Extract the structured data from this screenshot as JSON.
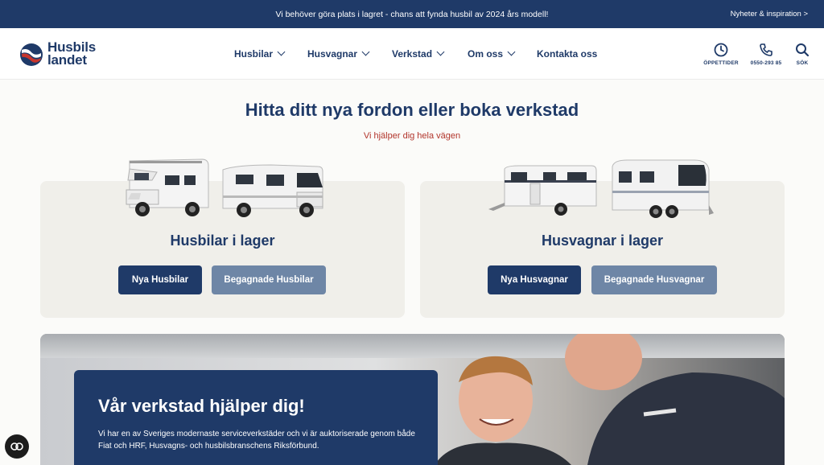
{
  "announcement": {
    "message": "Vi behöver göra plats i lagret - chans att fynda husbil av 2024 års modell!",
    "news_link": "Nyheter & inspiration >"
  },
  "header": {
    "logo": {
      "line1": "Husbils",
      "line2": "landet"
    },
    "nav": [
      {
        "label": "Husbilar"
      },
      {
        "label": "Husvagnar"
      },
      {
        "label": "Verkstad"
      },
      {
        "label": "Om oss"
      },
      {
        "label": "Kontakta oss"
      }
    ],
    "utilities": {
      "hours": "ÖPPETTIDER",
      "phone": "0550-293 85",
      "search": "SÖK"
    }
  },
  "hero": {
    "title": "Hitta ditt nya fordon eller boka verkstad",
    "subtitle": "Vi hjälper dig hela vägen"
  },
  "cards": {
    "motorhomes": {
      "title": "Husbilar i lager",
      "primary_button": "Nya Husbilar",
      "secondary_button": "Begagnade Husbilar"
    },
    "caravans": {
      "title": "Husvagnar i lager",
      "primary_button": "Nya Husvagnar",
      "secondary_button": "Begagnade Husvagnar"
    }
  },
  "workshop": {
    "title": "Vår verkstad hjälper dig!",
    "text": "Vi har en av Sveriges modernaste serviceverkstäder och vi är auktoriserade genom både Fiat och HRF, Husvagns- och husbilsbranschens Riksförbund."
  },
  "colors": {
    "brand_navy": "#1f3a68",
    "accent_red": "#b2352c",
    "secondary_button": "#6e86a6",
    "card_background": "#f0efea"
  },
  "icons": {
    "logo": "flag-logo-icon",
    "chevron": "chevron-down-icon",
    "hours": "clock-icon",
    "phone": "phone-icon",
    "search": "search-icon",
    "cookie": "cookie-settings-icon"
  }
}
